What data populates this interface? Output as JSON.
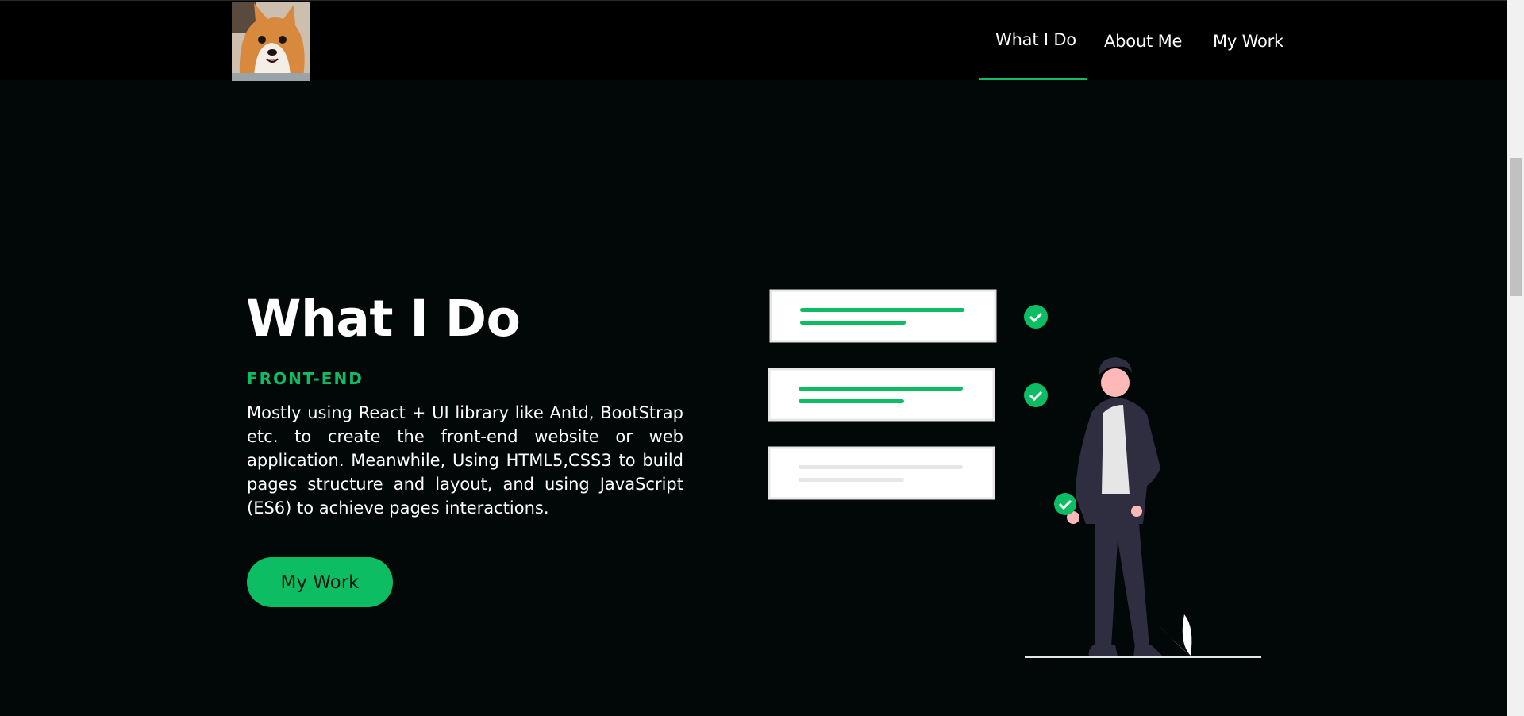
{
  "nav": {
    "items": [
      {
        "label": "What I Do",
        "active": true
      },
      {
        "label": "About Me"
      },
      {
        "label": "My Work"
      }
    ],
    "logo_icon": "shiba-avatar-icon"
  },
  "hero": {
    "title": "What I Do",
    "subtitle": "FRONT-END",
    "description": "Mostly using React + UI library like Antd, BootStrap etc. to create the front-end website or web application. Meanwhile, Using HTML5,CSS3 to build pages structure and layout, and using JavaScript (ES6) to achieve pages interactions.",
    "cta_label": "My Work"
  },
  "colors": {
    "accent": "#0cbd64",
    "background": "#020707",
    "navbar": "#000000",
    "text": "#ffffff"
  }
}
